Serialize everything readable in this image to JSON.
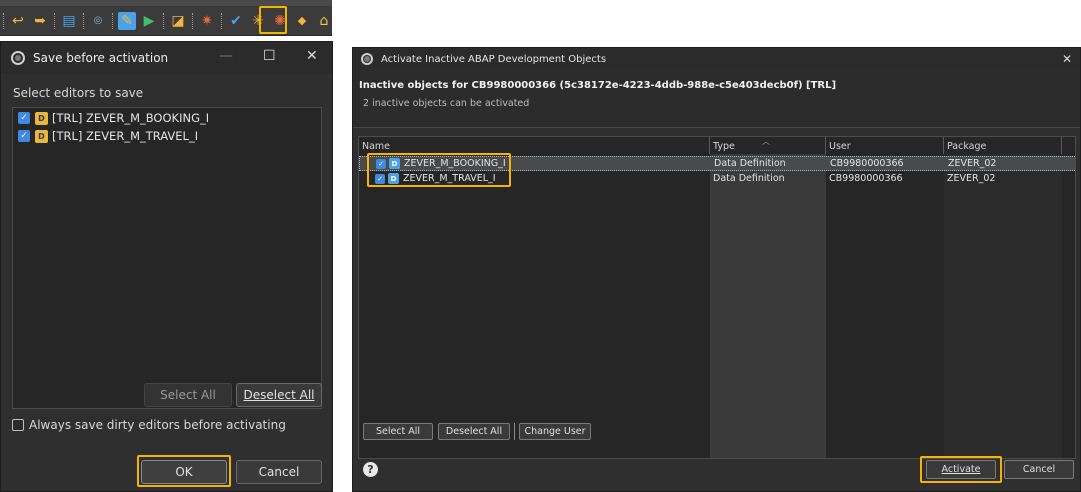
{
  "toolbar": {
    "icons": [
      "undo-arrow-icon",
      "redo-arrow-icon",
      "console-icon",
      "outline-icon",
      "edit-document-icon",
      "run-icon",
      "format-icon",
      "activate-icon",
      "check-icon",
      "star-icon",
      "activate-inactive-objects-icon",
      "transport-icon",
      "lock-icon"
    ]
  },
  "save_dialog": {
    "title": "Save before activation",
    "prompt": "Select editors to save",
    "editors": [
      {
        "label": "[TRL] ZEVER_M_BOOKING_I",
        "checked": true
      },
      {
        "label": "[TRL] ZEVER_M_TRAVEL_I",
        "checked": true
      }
    ],
    "select_all": "Select All",
    "deselect_all": "Deselect All",
    "always_save": "Always save dirty editors before activating",
    "ok": "OK",
    "cancel": "Cancel"
  },
  "activate_dialog": {
    "title": "Activate Inactive ABAP Development Objects",
    "heading": "Inactive objects for CB9980000366 (5c38172e-4223-4ddb-988e-c5e403decb0f) [TRL]",
    "subheading": "2 inactive objects can be activated",
    "columns": {
      "name": "Name",
      "type": "Type",
      "user": "User",
      "package": "Package"
    },
    "rows": [
      {
        "name": "ZEVER_M_BOOKING_I",
        "type": "Data Definition",
        "user": "CB9980000366",
        "package": "ZEVER_02",
        "checked": true,
        "selected": true
      },
      {
        "name": "ZEVER_M_TRAVEL_I",
        "type": "Data Definition",
        "user": "CB9980000366",
        "package": "ZEVER_02",
        "checked": true,
        "selected": false
      }
    ],
    "select_all": "Select All",
    "deselect_all": "Deselect All",
    "change_user": "Change User",
    "activate": "Activate",
    "cancel": "Cancel"
  },
  "colors": {
    "highlight": "#f4b400",
    "checkbox": "#3f8ae0",
    "dialog_bg": "#2f2f2f"
  }
}
